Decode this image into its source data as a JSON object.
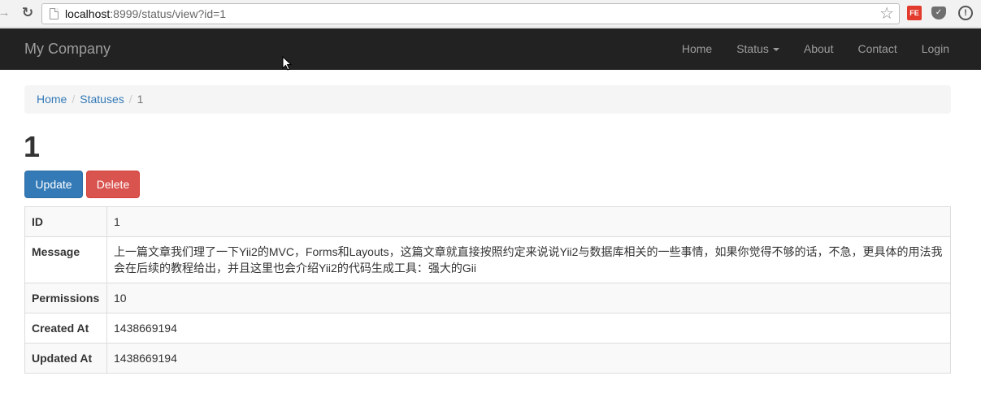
{
  "browser": {
    "url_host": "localhost",
    "url_rest": ":8999/status/view?id=1",
    "ext_fe_label": "FE"
  },
  "navbar": {
    "brand": "My Company",
    "items": [
      {
        "label": "Home"
      },
      {
        "label": "Status"
      },
      {
        "label": "About"
      },
      {
        "label": "Contact"
      },
      {
        "label": "Login"
      }
    ]
  },
  "breadcrumb": {
    "home": "Home",
    "statuses": "Statuses",
    "separator": "/",
    "current": "1"
  },
  "page": {
    "title": "1",
    "update_label": "Update",
    "delete_label": "Delete"
  },
  "details": {
    "rows": [
      {
        "label": "ID",
        "value": "1"
      },
      {
        "label": "Message",
        "value": "上一篇文章我们理了一下Yii2的MVC，Forms和Layouts，这篇文章就直接按照约定来说说Yii2与数据库相关的一些事情，如果你觉得不够的话，不急，更具体的用法我会在后续的教程给出，并且这里也会介绍Yii2的代码生成工具：强大的Gii"
      },
      {
        "label": "Permissions",
        "value": "10"
      },
      {
        "label": "Created At",
        "value": "1438669194"
      },
      {
        "label": "Updated At",
        "value": "1438669194"
      }
    ]
  },
  "colors": {
    "navbar_bg": "#222222",
    "link": "#337ab7",
    "update_button": "#337ab7",
    "delete_button": "#d9534f"
  }
}
